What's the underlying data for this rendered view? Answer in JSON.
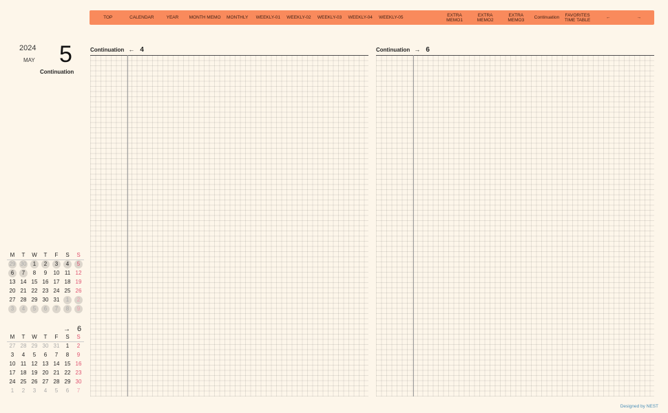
{
  "nav": [
    {
      "label": "TOP",
      "width": 54
    },
    {
      "label": "CALENDAR",
      "width": 45
    },
    {
      "label": "YEAR",
      "width": 45
    },
    {
      "label": "MONTH MEMO",
      "width": 50
    },
    {
      "label": "MONTHLY",
      "width": 45
    },
    {
      "label": "WEEKLY-01",
      "width": 45
    },
    {
      "label": "WEEKLY-02",
      "width": 45
    },
    {
      "label": "WEEKLY-03",
      "width": 45
    },
    {
      "label": "WEEKLY-04",
      "width": 45
    },
    {
      "label": "WEEKLY-05",
      "width": 45
    },
    {
      "label": "",
      "width": 48
    },
    {
      "label": "EXTRA\nMEMO1",
      "width": 45
    },
    {
      "label": "EXTRA\nMEMO2",
      "width": 45
    },
    {
      "label": "EXTRA\nMEMO3",
      "width": 45
    },
    {
      "label": "Continuation",
      "width": 45
    },
    {
      "label": "FAVORITES\nTIME TABLE",
      "width": 45
    },
    {
      "label": "←",
      "width": 45
    },
    {
      "label": "→",
      "width": 45
    }
  ],
  "side": {
    "year": "2024",
    "month": "MAY",
    "day": "5",
    "title": "Continuation"
  },
  "left_page": {
    "title": "Continuation",
    "arrow": "←",
    "page": "4"
  },
  "right_page": {
    "title": "Continuation",
    "arrow": "→",
    "page": "6"
  },
  "calendar_current": {
    "dows": [
      "M",
      "T",
      "W",
      "T",
      "F",
      "S",
      "S"
    ],
    "weeks": [
      [
        [
          "29",
          1,
          1
        ],
        [
          "30",
          1,
          1
        ],
        [
          "1",
          0,
          1
        ],
        [
          "2",
          0,
          1
        ],
        [
          "3",
          0,
          1
        ],
        [
          "4",
          0,
          1
        ],
        [
          "5",
          0,
          1
        ]
      ],
      [
        [
          "6",
          0,
          1
        ],
        [
          "7",
          0,
          1
        ],
        [
          "8",
          0,
          0
        ],
        [
          "9",
          0,
          0
        ],
        [
          "10",
          0,
          0
        ],
        [
          "11",
          0,
          0
        ],
        [
          "12",
          0,
          0
        ]
      ],
      [
        [
          "13",
          0,
          0
        ],
        [
          "14",
          0,
          0
        ],
        [
          "15",
          0,
          0
        ],
        [
          "16",
          0,
          0
        ],
        [
          "17",
          0,
          0
        ],
        [
          "18",
          0,
          0
        ],
        [
          "19",
          0,
          0
        ]
      ],
      [
        [
          "20",
          0,
          0
        ],
        [
          "21",
          0,
          0
        ],
        [
          "22",
          0,
          0
        ],
        [
          "23",
          0,
          0
        ],
        [
          "24",
          0,
          0
        ],
        [
          "25",
          0,
          0
        ],
        [
          "26",
          0,
          0
        ]
      ],
      [
        [
          "27",
          0,
          0
        ],
        [
          "28",
          0,
          0
        ],
        [
          "29",
          0,
          0
        ],
        [
          "30",
          0,
          0
        ],
        [
          "31",
          0,
          0
        ],
        [
          "1",
          1,
          1
        ],
        [
          "2",
          1,
          1
        ]
      ],
      [
        [
          "3",
          1,
          1
        ],
        [
          "4",
          1,
          1
        ],
        [
          "5",
          1,
          1
        ],
        [
          "6",
          1,
          1
        ],
        [
          "7",
          1,
          1
        ],
        [
          "8",
          1,
          1
        ],
        [
          "9",
          1,
          1
        ]
      ]
    ]
  },
  "next_nav": {
    "arrow": "→",
    "page": "6"
  },
  "calendar_next": {
    "dows": [
      "M",
      "T",
      "W",
      "T",
      "F",
      "S",
      "S"
    ],
    "weeks": [
      [
        [
          "27",
          1
        ],
        [
          "28",
          1
        ],
        [
          "29",
          1
        ],
        [
          "30",
          1
        ],
        [
          "31",
          1
        ],
        [
          "1",
          0
        ],
        [
          "2",
          0
        ]
      ],
      [
        [
          "3",
          0
        ],
        [
          "4",
          0
        ],
        [
          "5",
          0
        ],
        [
          "6",
          0
        ],
        [
          "7",
          0
        ],
        [
          "8",
          0
        ],
        [
          "9",
          0
        ]
      ],
      [
        [
          "10",
          0
        ],
        [
          "11",
          0
        ],
        [
          "12",
          0
        ],
        [
          "13",
          0
        ],
        [
          "14",
          0
        ],
        [
          "15",
          0
        ],
        [
          "16",
          0
        ]
      ],
      [
        [
          "17",
          0
        ],
        [
          "18",
          0
        ],
        [
          "19",
          0
        ],
        [
          "20",
          0
        ],
        [
          "21",
          0
        ],
        [
          "22",
          0
        ],
        [
          "23",
          0
        ]
      ],
      [
        [
          "24",
          0
        ],
        [
          "25",
          0
        ],
        [
          "26",
          0
        ],
        [
          "27",
          0
        ],
        [
          "28",
          0
        ],
        [
          "29",
          0
        ],
        [
          "30",
          0
        ]
      ],
      [
        [
          "1",
          1
        ],
        [
          "2",
          1
        ],
        [
          "3",
          1
        ],
        [
          "4",
          1
        ],
        [
          "5",
          1
        ],
        [
          "6",
          1
        ],
        [
          "7",
          1
        ]
      ]
    ]
  },
  "credit": "Designed by NEST",
  "colors": {
    "nav_bg": "#f98a5c",
    "page_bg": "#fdf6ea",
    "sunday": "#e0506e",
    "credit": "#4a8fb8"
  }
}
